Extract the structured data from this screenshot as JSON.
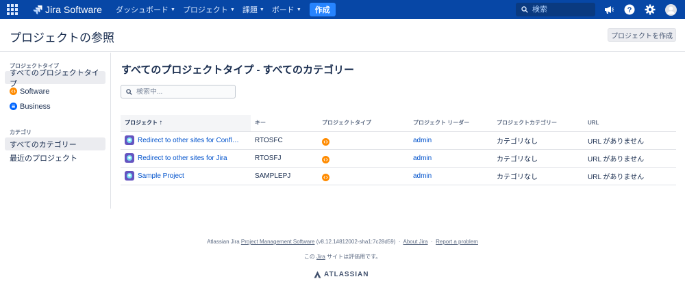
{
  "nav": {
    "logo_text": "Jira Software",
    "menu": [
      {
        "label": "ダッシュボード"
      },
      {
        "label": "プロジェクト"
      },
      {
        "label": "課題"
      },
      {
        "label": "ボード"
      }
    ],
    "create_label": "作成",
    "search_placeholder": "検索",
    "brand_color": "#0747a6"
  },
  "header": {
    "title": "プロジェクトの参照",
    "create_project_label": "プロジェクトを作成"
  },
  "sidebar": {
    "project_type_heading": "プロジェクトタイプ",
    "project_types": [
      {
        "label": "すべてのプロジェクトタイプ",
        "icon": "none",
        "active": true
      },
      {
        "label": "Software",
        "icon": "software-icon",
        "active": false
      },
      {
        "label": "Business",
        "icon": "business-icon",
        "active": false
      }
    ],
    "category_heading": "カテゴリ",
    "categories": [
      {
        "label": "すべてのカテゴリー",
        "active": true
      },
      {
        "label": "最近のプロジェクト",
        "active": false
      }
    ]
  },
  "main": {
    "title": "すべてのプロジェクトタイプ - すべてのカテゴリー",
    "filter_placeholder": "検索中...",
    "columns": [
      "プロジェクト",
      "キー",
      "プロジェクトタイプ",
      "プロジェクト リーダー",
      "プロジェクトカテゴリー",
      "URL"
    ],
    "sort_indicator": "↑",
    "rows": [
      {
        "name": "Redirect to other sites for Confl…",
        "key": "RTOSFC",
        "type_icon": "software-icon",
        "lead": "admin",
        "category": "カテゴリなし",
        "url": "URL がありません"
      },
      {
        "name": "Redirect to other sites for Jira",
        "key": "RTOSFJ",
        "type_icon": "software-icon",
        "lead": "admin",
        "category": "カテゴリなし",
        "url": "URL がありません"
      },
      {
        "name": "Sample Project",
        "key": "SAMPLEPJ",
        "type_icon": "software-icon",
        "lead": "admin",
        "category": "カテゴリなし",
        "url": "URL がありません"
      }
    ]
  },
  "footer": {
    "prefix": "Atlassian Jira",
    "pms_link": "Project Management Software",
    "version": "(v8.12.1#812002-sha1:7c28d59)",
    "sep": "·",
    "about_link": "About Jira",
    "report_link": "Report a problem",
    "eval_prefix": "この",
    "eval_link": "Jira",
    "eval_suffix": "サイトは評価用です。",
    "logo_text": "ATLASSIAN"
  }
}
